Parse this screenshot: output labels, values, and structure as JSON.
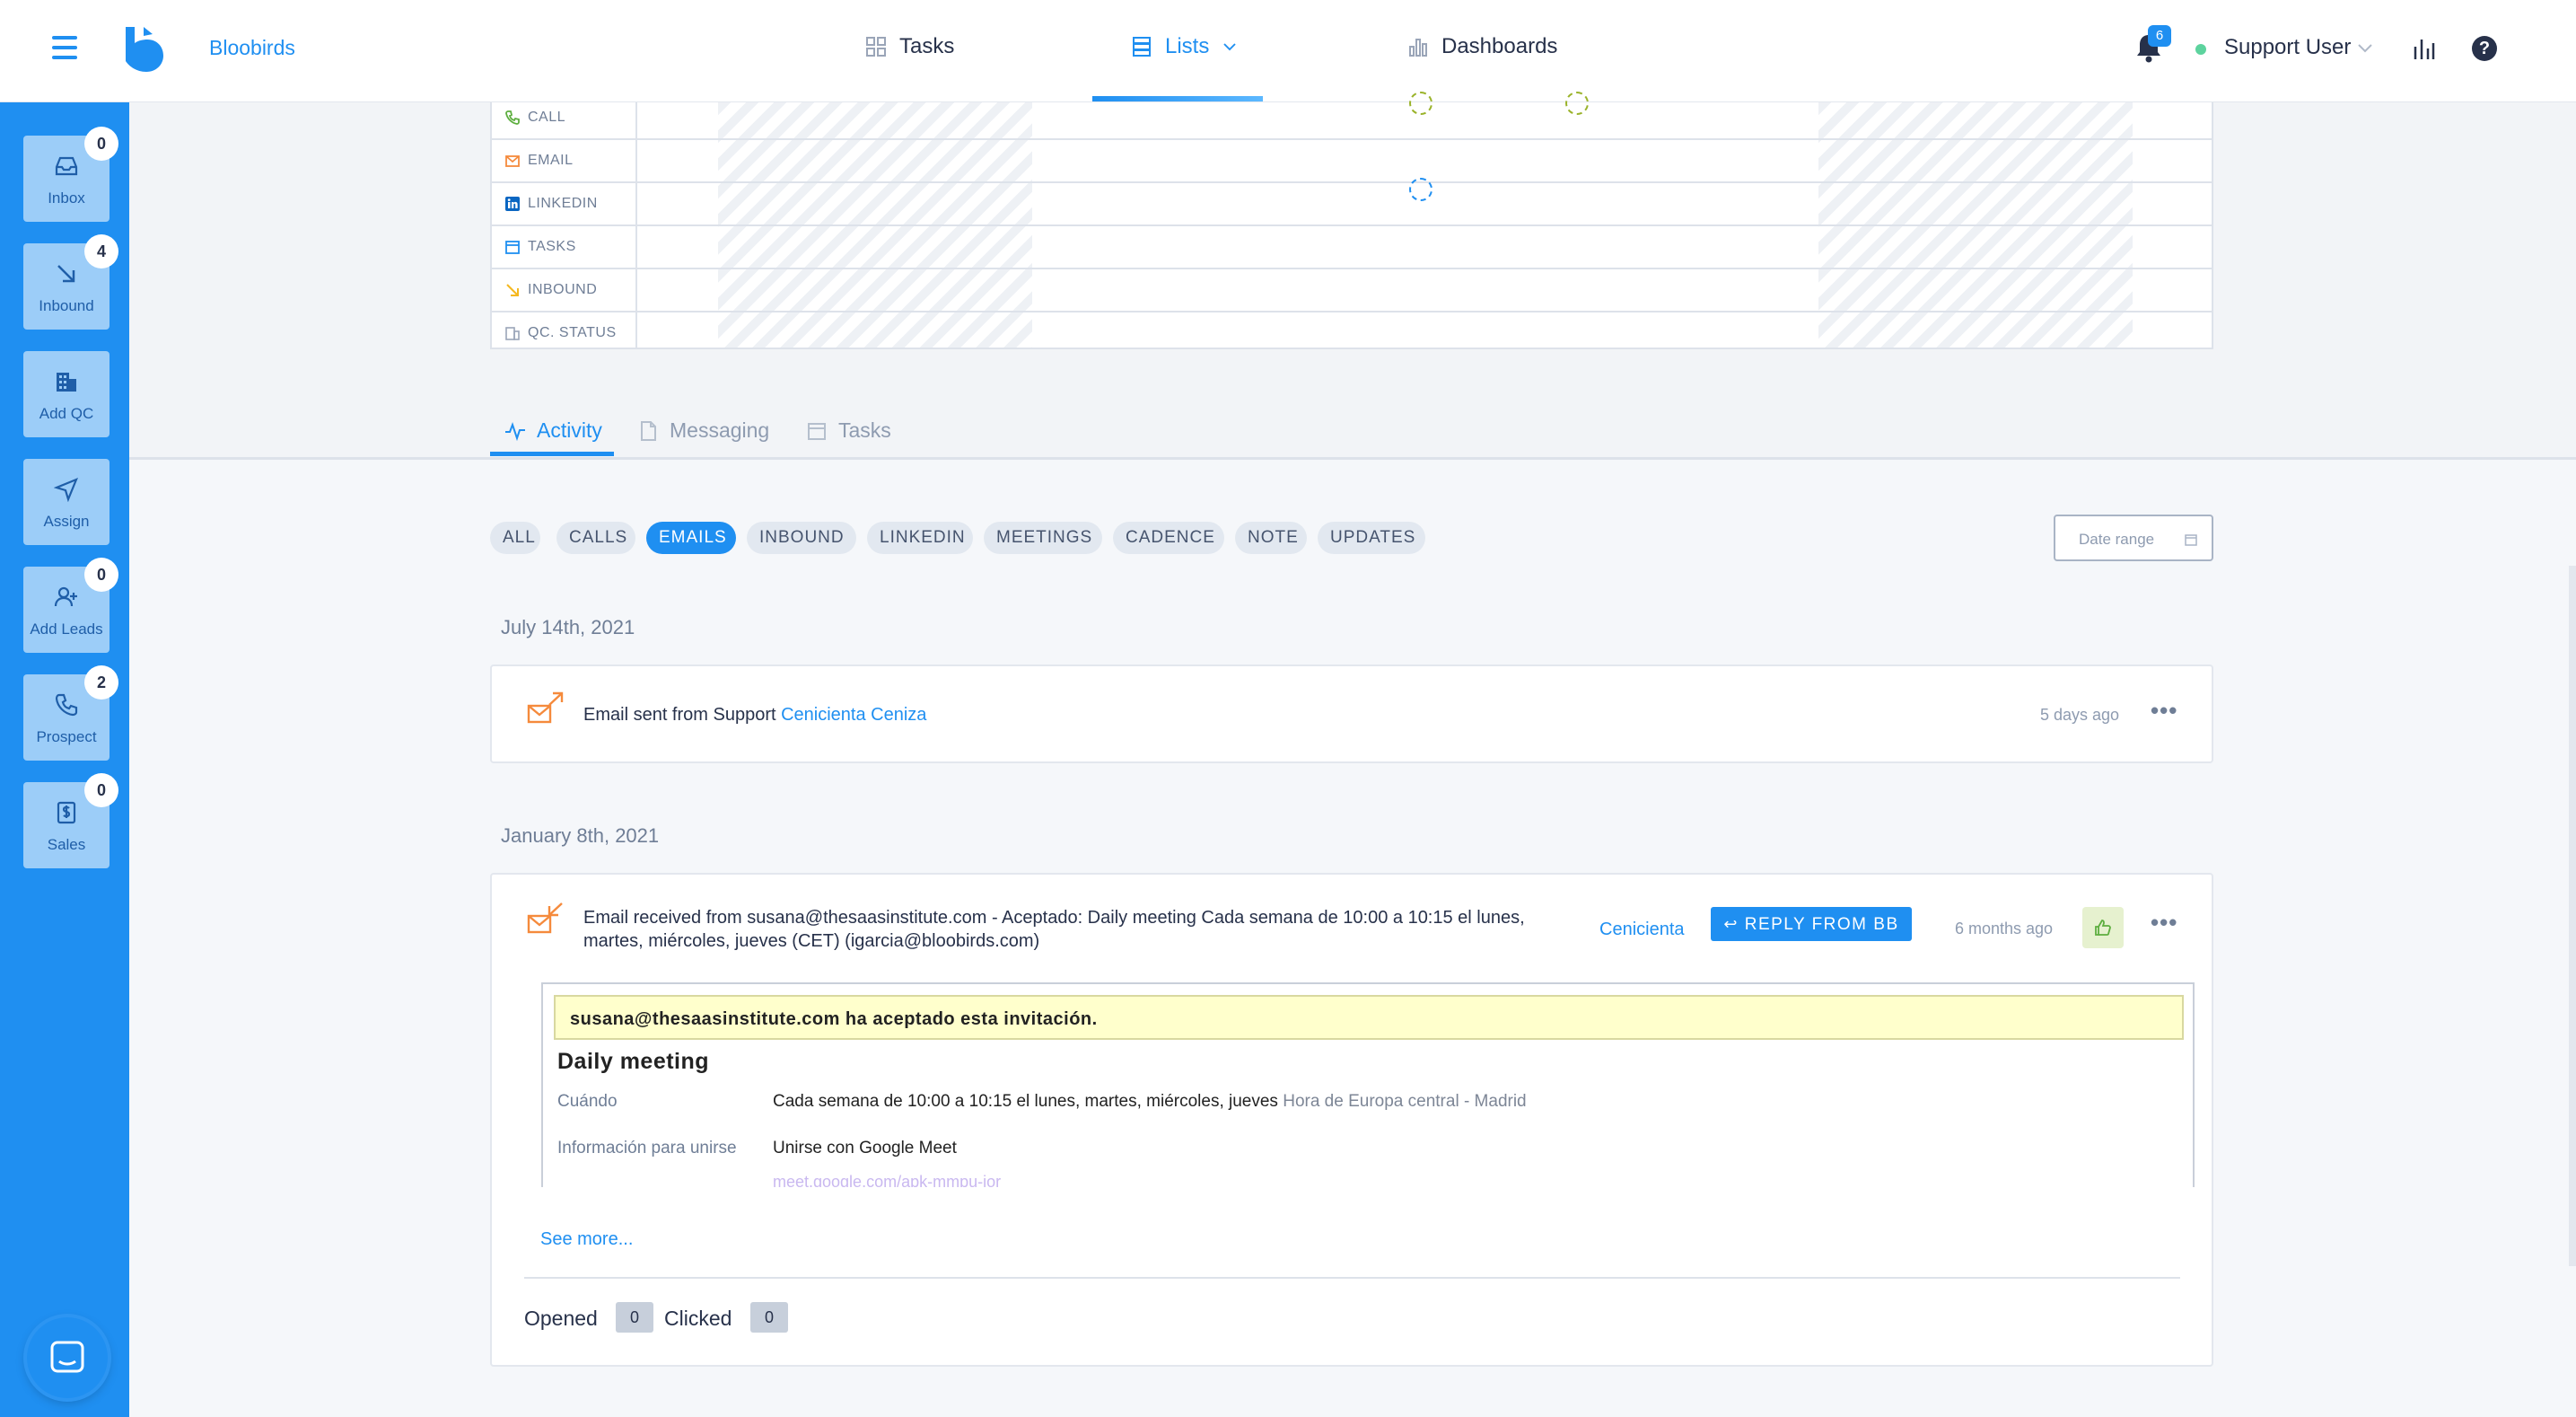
{
  "header": {
    "brand": "Bloobirds",
    "nav": [
      {
        "label": "Tasks",
        "icon": "grid-icon"
      },
      {
        "label": "Lists",
        "icon": "list-icon"
      },
      {
        "label": "Dashboards",
        "icon": "bar-chart-icon"
      }
    ],
    "notifications_count": "6",
    "user_name": "Support User"
  },
  "sidebar": {
    "items": [
      {
        "label": "Inbox",
        "badge": "0",
        "icon": "inbox-icon"
      },
      {
        "label": "Inbound",
        "badge": "4",
        "icon": "arrow-down-right-icon"
      },
      {
        "label": "Add QC",
        "badge": "",
        "icon": "building-icon"
      },
      {
        "label": "Assign",
        "badge": "",
        "icon": "send-icon"
      },
      {
        "label": "Add Leads",
        "badge": "0",
        "icon": "add-user-icon"
      },
      {
        "label": "Prospect",
        "badge": "2",
        "icon": "phone-icon"
      },
      {
        "label": "Sales",
        "badge": "0",
        "icon": "dollar-icon"
      }
    ]
  },
  "grid": {
    "rows": [
      "CALL",
      "EMAIL",
      "LINKEDIN",
      "TASKS",
      "INBOUND",
      "QC. STATUS"
    ]
  },
  "tabs": [
    {
      "label": "Activity",
      "active": true
    },
    {
      "label": "Messaging",
      "active": false
    },
    {
      "label": "Tasks",
      "active": false
    }
  ],
  "filters": [
    "ALL",
    "CALLS",
    "EMAILS",
    "INBOUND",
    "LINKEDIN",
    "MEETINGS",
    "CADENCE",
    "NOTE",
    "UPDATES"
  ],
  "active_filter": "EMAILS",
  "date_range_placeholder": "Date range",
  "groups": [
    {
      "date": "July 14th, 2021",
      "activity": {
        "text": "Email sent from Support",
        "lead": "Cenicienta Ceniza",
        "time": "5 days ago"
      }
    },
    {
      "date": "January 8th, 2021",
      "activity": {
        "text": "Email received from susana@thesaasinstitute.com - Aceptado: Daily meeting Cada semana de 10:00 a 10:15 el lunes, martes, miércoles, jueves (CET) (igarcia@bloobirds.com)",
        "lead": "Cenicienta",
        "reply_label": "REPLY FROM BB",
        "time": "6 months ago",
        "preview": {
          "banner": "susana@thesaasinstitute.com ha aceptado esta invitación.",
          "title": "Daily meeting",
          "when_label": "Cuándo",
          "when_value": "Cada semana de 10:00 a 10:15 el lunes, martes, miércoles, jueves",
          "when_tz": "Hora de Europa central - Madrid",
          "join_label": "Información para unirse",
          "join_value": "Unirse con Google Meet",
          "join_link": "meet.google.com/apk-mmpu-jor"
        },
        "see_more": "See more...",
        "opened_label": "Opened",
        "opened_count": "0",
        "clicked_label": "Clicked",
        "clicked_count": "0"
      }
    }
  ],
  "colors": {
    "accent": "#1f8ff1",
    "sidebar": "#1f8ff1",
    "email_icon": "#f58a3c",
    "text": "#27314a"
  }
}
